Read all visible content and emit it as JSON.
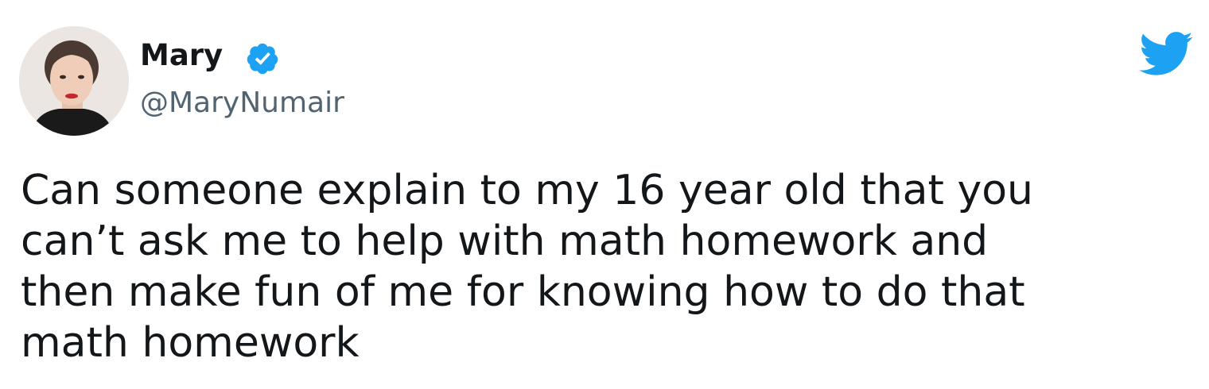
{
  "tweet": {
    "author": {
      "display_name": "Mary",
      "handle": "@MaryNumair",
      "verified": true,
      "avatar_icon": "profile-photo"
    },
    "brand_icon": "twitter-bird-icon",
    "brand_color": "#1da1f2",
    "text_lines": [
      "Can someone explain to my 16 year old that you",
      "can’t ask me to help with math homework and",
      "then make fun of me for knowing how to do that",
      "math homework"
    ]
  }
}
